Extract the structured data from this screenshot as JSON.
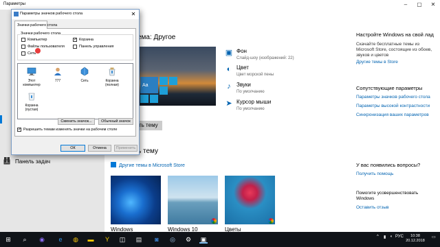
{
  "window": {
    "title": "Параметры"
  },
  "sidebar": {
    "items": [
      {
        "label": ""
      },
      {
        "label": "Панель задач"
      }
    ]
  },
  "main": {
    "current_theme": "ема: Другое",
    "preview_tile_text": "Aa",
    "apply_button": "ть тему",
    "options": [
      {
        "name": "Фон",
        "sub": "Слайд-шоу (изображений: 22)"
      },
      {
        "name": "Цвет",
        "sub": "Цвет морской пены"
      },
      {
        "name": "Звуки",
        "sub": "По умолчанию"
      },
      {
        "name": "Курсор мыши",
        "sub": "По умолчанию"
      }
    ],
    "apply_section_title": "ь тему",
    "store_link": "Другие темы в Microsoft Store",
    "themes": [
      {
        "label": "Windows"
      },
      {
        "label": "Windows 10"
      },
      {
        "label": "Цветы"
      }
    ]
  },
  "right": {
    "heading1": "Настройте Windows на свой лад",
    "text1": "Скачайте бесплатные темы из Microsoft Store, состоящие из обоев, звуков и цветов",
    "link1": "Другие темы в Store",
    "heading2": "Сопутствующие параметры",
    "links2": [
      "Параметры значков рабочего стола",
      "Параметры высокой контрастности",
      "Синхронизация ваших параметров"
    ],
    "heading3": "У вас появились вопросы?",
    "link3": "Получить помощь",
    "heading4": "Помогите усовершенствовать Windows",
    "link4": "Оставить отзыв"
  },
  "dialog": {
    "title": "Параметры значков рабочего стола",
    "tab": "Значки рабочего стола",
    "group_label": "Значки рабочего стола",
    "checkboxes": [
      {
        "label": "Компьютер",
        "checked": false
      },
      {
        "label": "Корзина",
        "checked": true
      },
      {
        "label": "Файлы пользователя",
        "checked": false
      },
      {
        "label": "Панель управления",
        "checked": false
      },
      {
        "label": "Сеть",
        "checked": false
      }
    ],
    "icons": [
      {
        "label": "Этот компьютер"
      },
      {
        "label": "777"
      },
      {
        "label": "Сеть"
      },
      {
        "label": "Корзина (полная)"
      },
      {
        "label": "Корзина (пустая)"
      }
    ],
    "change_icon_button": "Сменить значок...",
    "default_button": "Обычный значок",
    "allow_themes_label": "Разрешить темам изменять значки на рабочем столе",
    "ok_button": "ОК",
    "cancel_button": "Отмена",
    "apply_button": "Применить"
  },
  "taskbar": {
    "time": "10:38",
    "date": "20.12.2018",
    "lang": "РУС"
  }
}
